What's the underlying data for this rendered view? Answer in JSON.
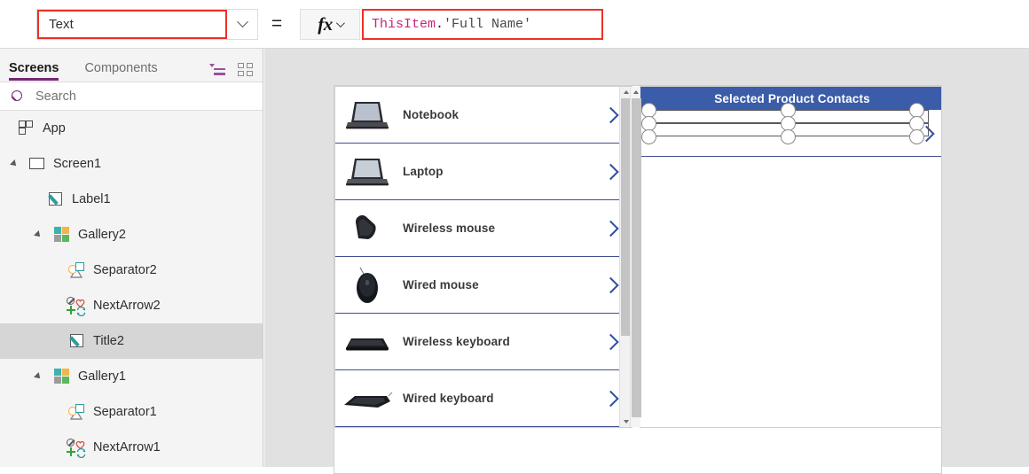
{
  "formula_bar": {
    "property_value": "Text",
    "property_dropdown_icon": "chevron-down-icon",
    "equals": "=",
    "fx_label": "fx",
    "fx_dropdown_icon": "chevron-down-icon",
    "formula_tokens": {
      "object": "ThisItem",
      "dot": ".",
      "field": "'Full Name'"
    },
    "highlight_color": "#ee3124",
    "token_color_object": "#c4267c",
    "token_color_field": "#4a4a4a"
  },
  "tree_pane": {
    "tabs": [
      {
        "label": "Screens",
        "active": true
      },
      {
        "label": "Components",
        "active": false
      }
    ],
    "view_icons": [
      {
        "name": "tree-list-view-icon",
        "active": true,
        "color": "#9b4f9b"
      },
      {
        "name": "tree-thumbnail-view-icon",
        "active": false,
        "color": "#8d8d8d"
      }
    ],
    "search": {
      "placeholder": "Search",
      "icon": "search-icon"
    },
    "items": [
      {
        "label": "App",
        "icon": "app-icon",
        "indent": 20,
        "expander": "none",
        "selected": false
      },
      {
        "label": "Screen1",
        "icon": "screen-icon",
        "indent": 32,
        "expander": "expanded",
        "selected": false
      },
      {
        "label": "Label1",
        "icon": "label-icon",
        "indent": 53,
        "expander": "none",
        "selected": false
      },
      {
        "label": "Gallery2",
        "icon": "gallery-icon",
        "indent": 60,
        "expander": "expanded",
        "selected": false
      },
      {
        "label": "Separator2",
        "icon": "separator-icon",
        "indent": 77,
        "expander": "none",
        "selected": false
      },
      {
        "label": "NextArrow2",
        "icon": "next-arrow-icon",
        "indent": 75,
        "expander": "none",
        "selected": false
      },
      {
        "label": "Title2",
        "icon": "label-icon",
        "indent": 77,
        "expander": "none",
        "selected": true
      },
      {
        "label": "Gallery1",
        "icon": "gallery-icon",
        "indent": 60,
        "expander": "expanded",
        "selected": false
      },
      {
        "label": "Separator1",
        "icon": "separator-icon",
        "indent": 77,
        "expander": "none",
        "selected": false
      },
      {
        "label": "NextArrow1",
        "icon": "next-arrow-icon",
        "indent": 75,
        "expander": "none",
        "selected": false
      }
    ],
    "accent_color": "#742774"
  },
  "canvas": {
    "background_color": "#e1e1e1",
    "product_gallery": {
      "name": "Gallery1",
      "items": [
        {
          "label": "Notebook",
          "image": "notebook-thumbnail",
          "chevron": "next-arrow-icon"
        },
        {
          "label": "Laptop",
          "image": "laptop-thumbnail",
          "chevron": "next-arrow-icon"
        },
        {
          "label": "Wireless mouse",
          "image": "wireless-mouse-thumbnail",
          "chevron": "next-arrow-icon"
        },
        {
          "label": "Wired mouse",
          "image": "wired-mouse-thumbnail",
          "chevron": "next-arrow-icon"
        },
        {
          "label": "Wireless keyboard",
          "image": "wireless-keyboard-thumbnail",
          "chevron": "next-arrow-icon"
        },
        {
          "label": "Wired keyboard",
          "image": "wired-keyboard-thumbnail",
          "chevron": "next-arrow-icon"
        }
      ],
      "separator_color": "#3f4f8f",
      "chevron_color": "#2f4fa0",
      "scrollbar": {
        "up_icon": "scroll-up-arrow-icon",
        "down_icon": "scroll-down-arrow-icon"
      }
    },
    "contacts_gallery": {
      "name": "Gallery2",
      "header_title": "Selected Product Contacts",
      "header_background": "#3b5ca8",
      "header_text_color": "#ffffff",
      "selected_item": {
        "label": "",
        "chevron": "next-arrow-icon",
        "handles": "resize-handles"
      }
    }
  }
}
